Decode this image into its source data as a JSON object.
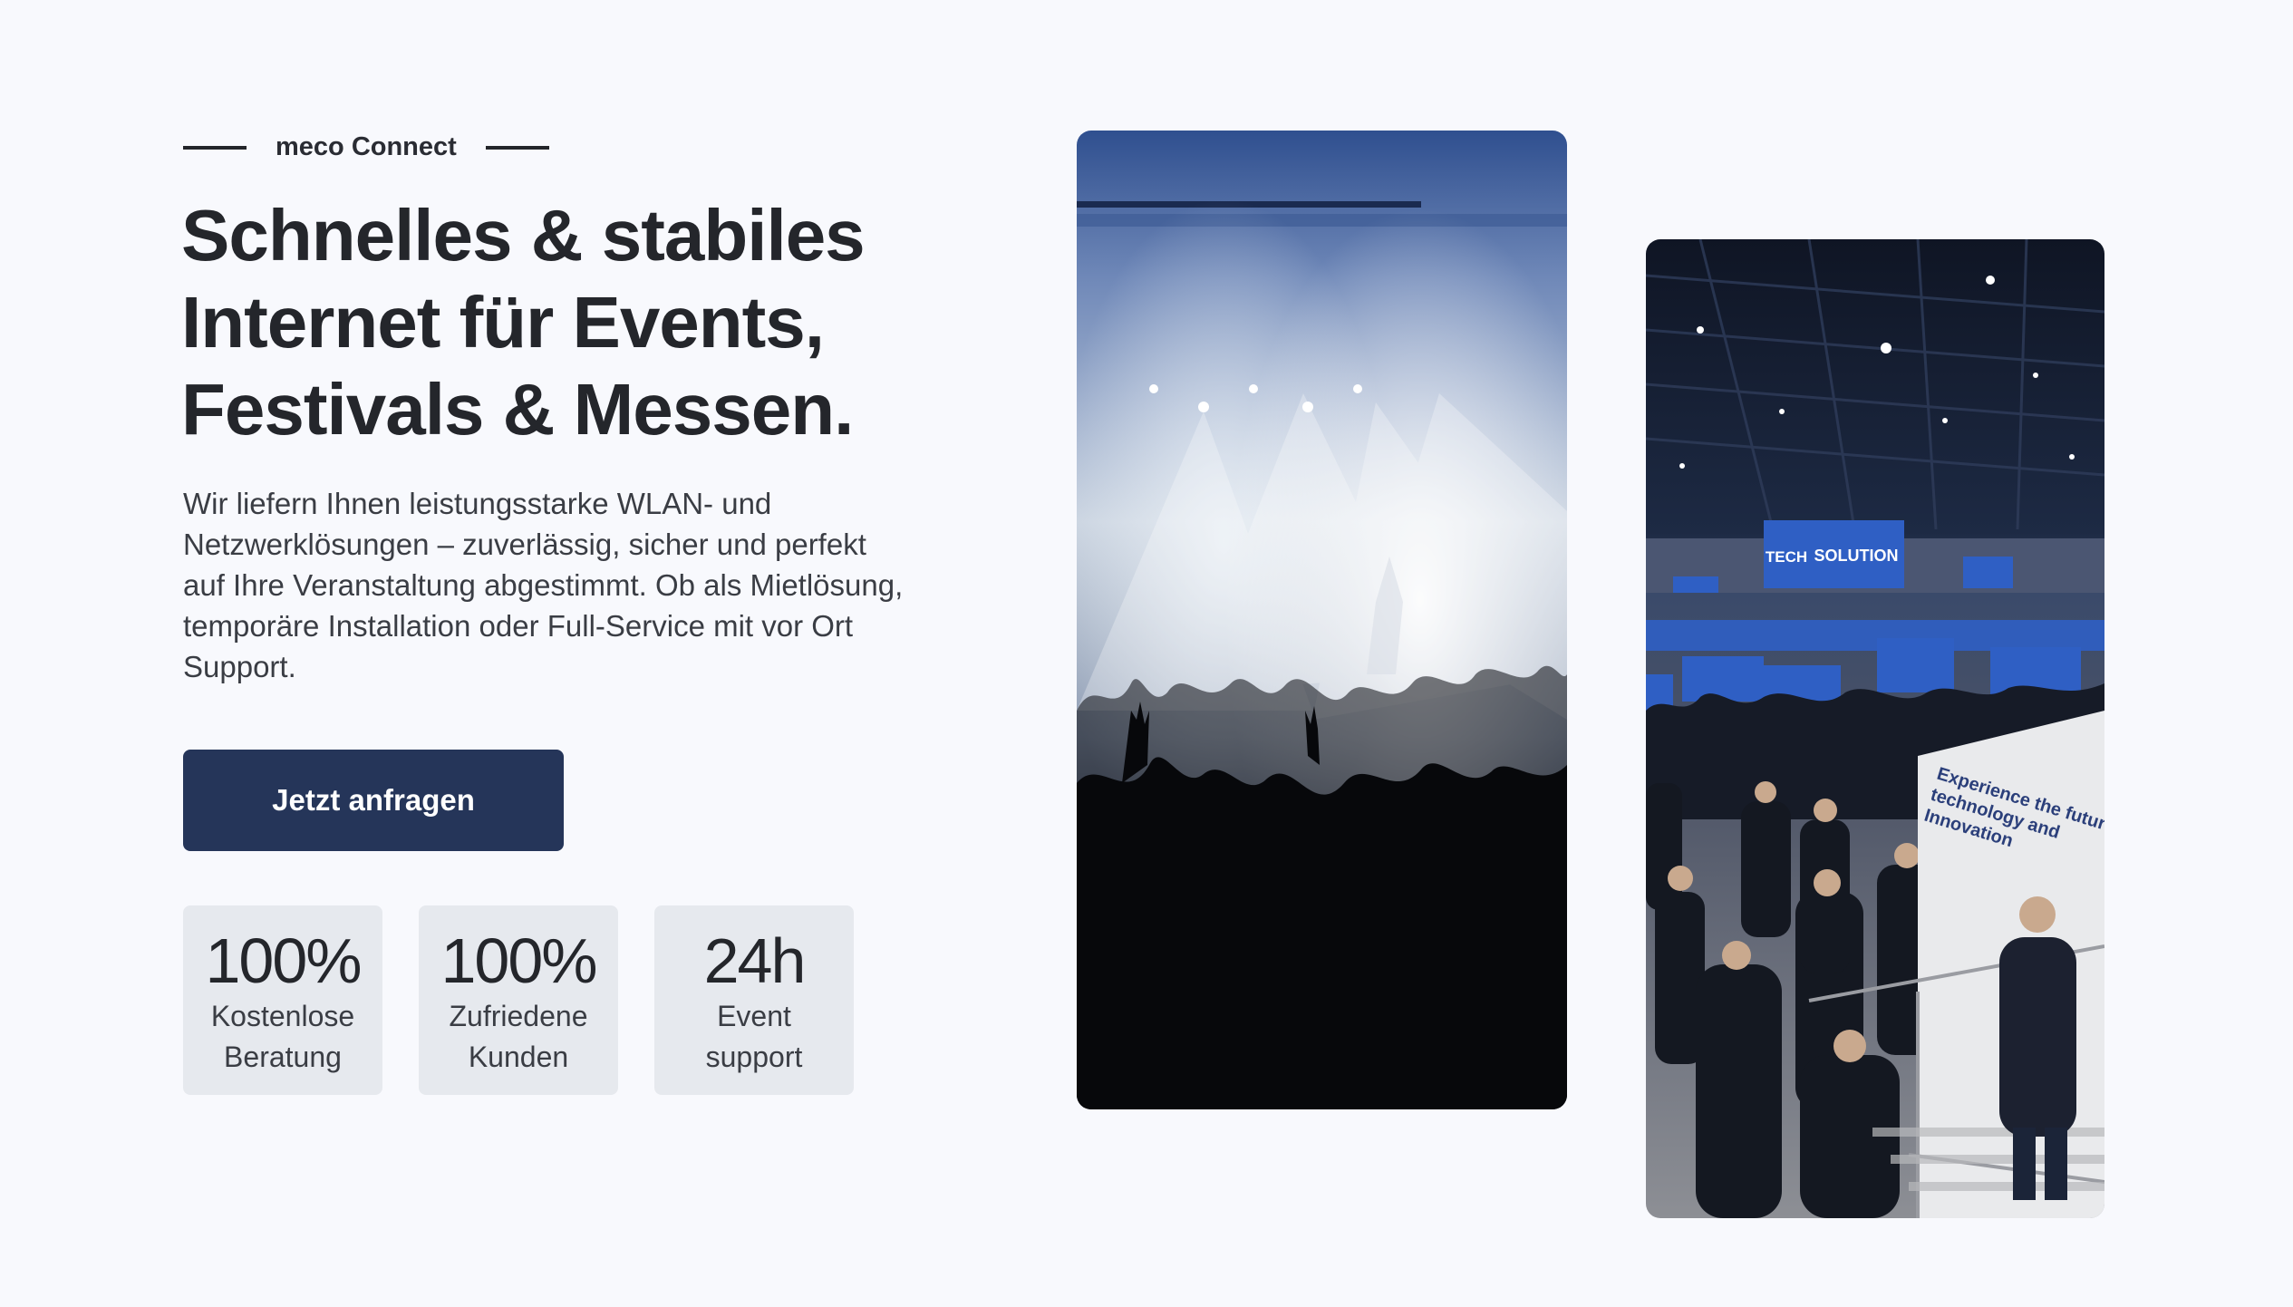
{
  "hero": {
    "eyebrow": "meco Connect",
    "headline_lines": [
      "Schnelles & stabiles",
      "Internet für Events,",
      "Festivals & Messen."
    ],
    "lead_lines": [
      "Wir liefern Ihnen leistungsstarke WLAN- und",
      "Netzwerklösungen – zuverlässig, sicher und perfekt",
      "auf Ihre Veranstaltung abgestimmt. Ob als Mietlösung,",
      "temporäre Installation oder Full-Service mit vor Ort",
      "Support."
    ],
    "cta_label": "Jetzt anfragen"
  },
  "stats": [
    {
      "value": "100%",
      "caption_lines": [
        "Kostenlose",
        "Beratung"
      ]
    },
    {
      "value": "100%",
      "caption_lines": [
        "Zufriedene",
        "Kunden"
      ]
    },
    {
      "value": "24h",
      "caption_lines": [
        "Event",
        "support"
      ]
    }
  ],
  "images": {
    "expo_signs": {
      "booth_left": "TECH",
      "booth_right": "SOLUTION",
      "wall_lines": [
        "Experience the future",
        "technology and",
        "Innovation"
      ]
    }
  },
  "colors": {
    "background": "#f8f9fd",
    "text": "#24262b",
    "button": "#253559",
    "stat_card": "#e6e9ee",
    "booth_blue": "#2f5fc4"
  }
}
